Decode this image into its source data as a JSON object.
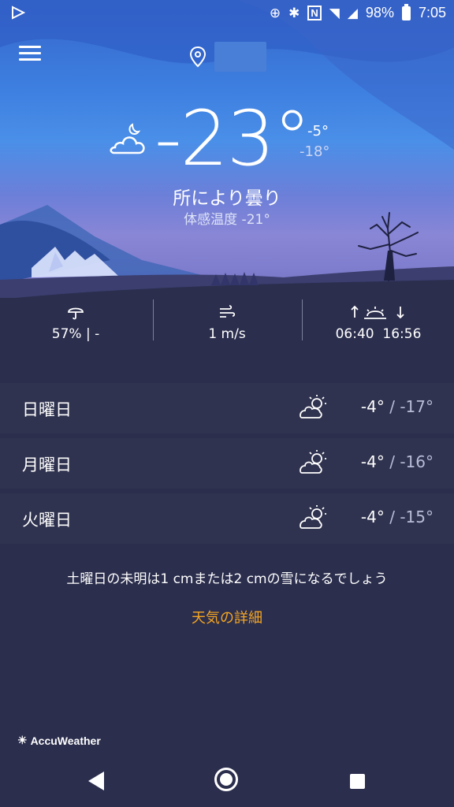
{
  "status_bar": {
    "battery": "98%",
    "time": "7:05"
  },
  "current": {
    "temperature": "-23°",
    "high": "-5°",
    "low": "-18°",
    "condition": "所により曇り",
    "feels_like": "体感温度 -21°"
  },
  "stats": {
    "precipitation": "57% | -",
    "wind": "1 m/s",
    "sunrise_sunset": "06:40  16:56"
  },
  "forecast": [
    {
      "day": "日曜日",
      "high": "-4°",
      "low": "-17°"
    },
    {
      "day": "月曜日",
      "high": "-4°",
      "low": "-16°"
    },
    {
      "day": "火曜日",
      "high": "-4°",
      "low": "-15°"
    }
  ],
  "snow_note": "土曜日の未明は1 cmまたは2 cmの雪になるでしょう",
  "details_link": "天気の詳細",
  "brand": "AccuWeather",
  "separator": " / "
}
